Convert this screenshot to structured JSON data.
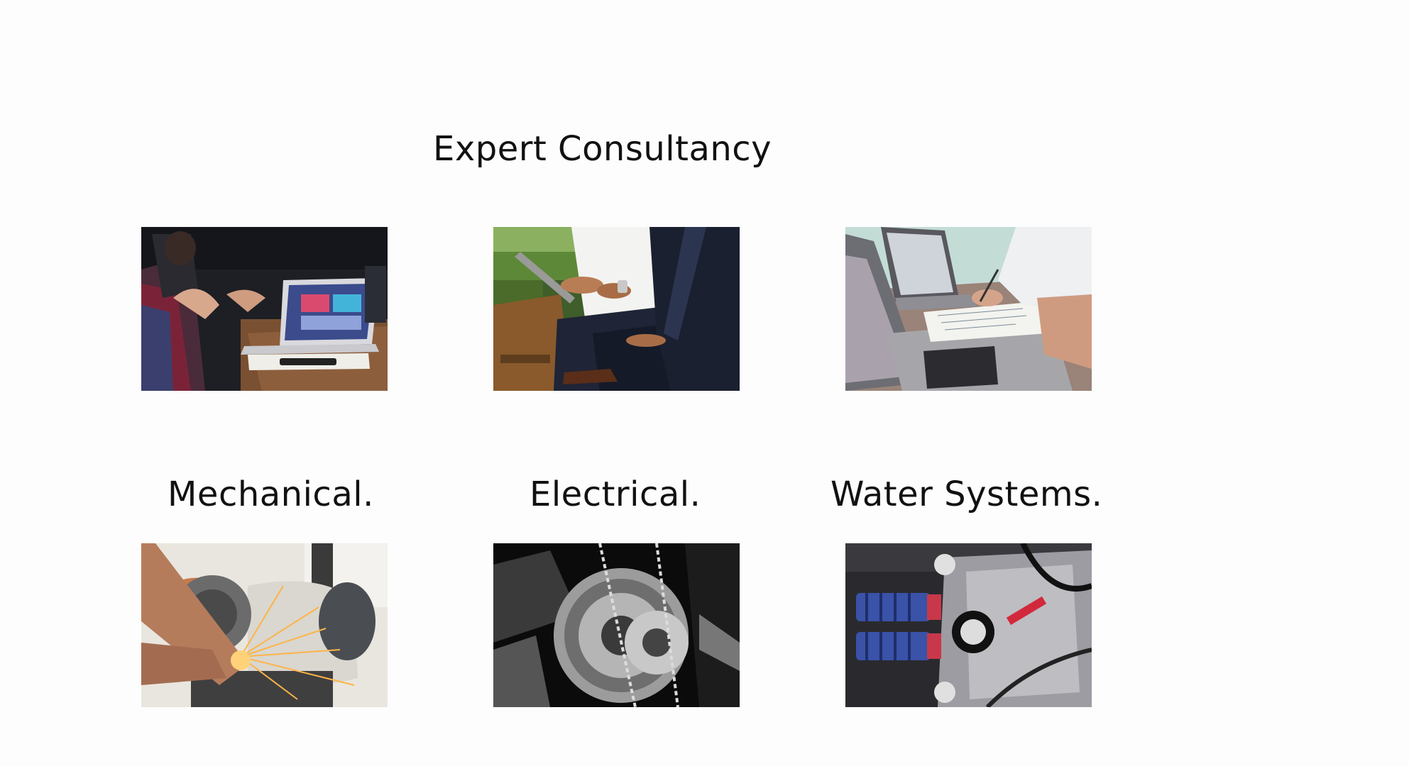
{
  "section": {
    "title": "Expert Consultancy"
  },
  "consultancy_images": [
    {
      "icon": "team-meeting-laptop-photo"
    },
    {
      "icon": "business-discussion-tablet-photo"
    },
    {
      "icon": "desk-planning-laptop-photo"
    }
  ],
  "services": [
    {
      "label": "Mechanical.",
      "icon": "angle-grinder-sparks-photo"
    },
    {
      "label": "Electrical.",
      "icon": "gear-chain-machinery-photo"
    },
    {
      "label": "Water Systems.",
      "icon": "engine-suspension-parts-photo"
    }
  ],
  "colors": {
    "background": "#fdfdfd",
    "text": "#111111"
  }
}
